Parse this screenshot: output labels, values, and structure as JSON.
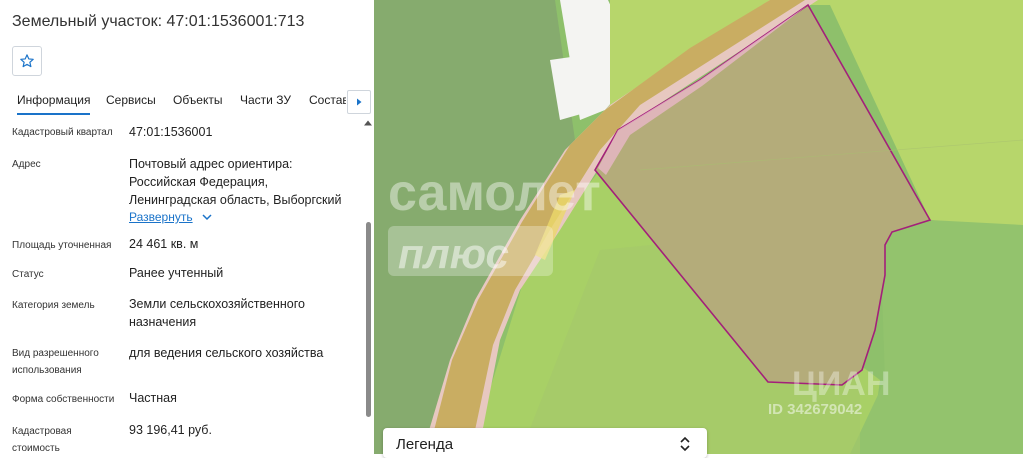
{
  "header": {
    "title": "Земельный участок: 47:01:1536001:713"
  },
  "tabs": [
    "Информация",
    "Сервисы",
    "Объекты",
    "Части ЗУ",
    "Состав"
  ],
  "info": {
    "cadastral_quarter": {
      "label": "Кадастровый квартал",
      "value": "47:01:1536001"
    },
    "address": {
      "label": "Адрес",
      "lines": [
        "Почтовый адрес ориентира:",
        "Российская Федерация,",
        "Ленинградская область, Выборгский"
      ],
      "expand_link": "Развернуть"
    },
    "area": {
      "label": "Площадь уточненная",
      "value": "24 461 кв. м"
    },
    "status": {
      "label": "Статус",
      "value": "Ранее учтенный"
    },
    "category": {
      "label": "Категория земель",
      "value_lines": [
        "Земли сельскохозяйственного",
        "назначения"
      ]
    },
    "permitted_use": {
      "label_lines": [
        "Вид разрешенного",
        "использования"
      ],
      "value": "для ведения сельского хозяйства"
    },
    "ownership": {
      "label": "Форма собственности",
      "value": "Частная"
    },
    "cadastral_value": {
      "label_lines": [
        "Кадастровая",
        "стоимость"
      ],
      "value": "93 196,41 руб."
    }
  },
  "map": {
    "watermark_main": "самолет",
    "watermark_sub": "плюс",
    "cian_logo": "ЦИАН",
    "cian_id": "ID 342679042",
    "colors": {
      "field": "#b7d66b",
      "forest": "#8ec06b",
      "dark_forest": "#86ab6e",
      "road": "#c9ad62",
      "parcel_border": "#a3207a",
      "parcel_fill": "#b4ac7a"
    }
  },
  "legend": {
    "label": "Легенда"
  },
  "icons": {
    "star": "star-icon",
    "tab_next": "chevron-right-icon",
    "expand": "chevron-down-icon",
    "legend_toggle": "chevron-up-down-icon"
  }
}
